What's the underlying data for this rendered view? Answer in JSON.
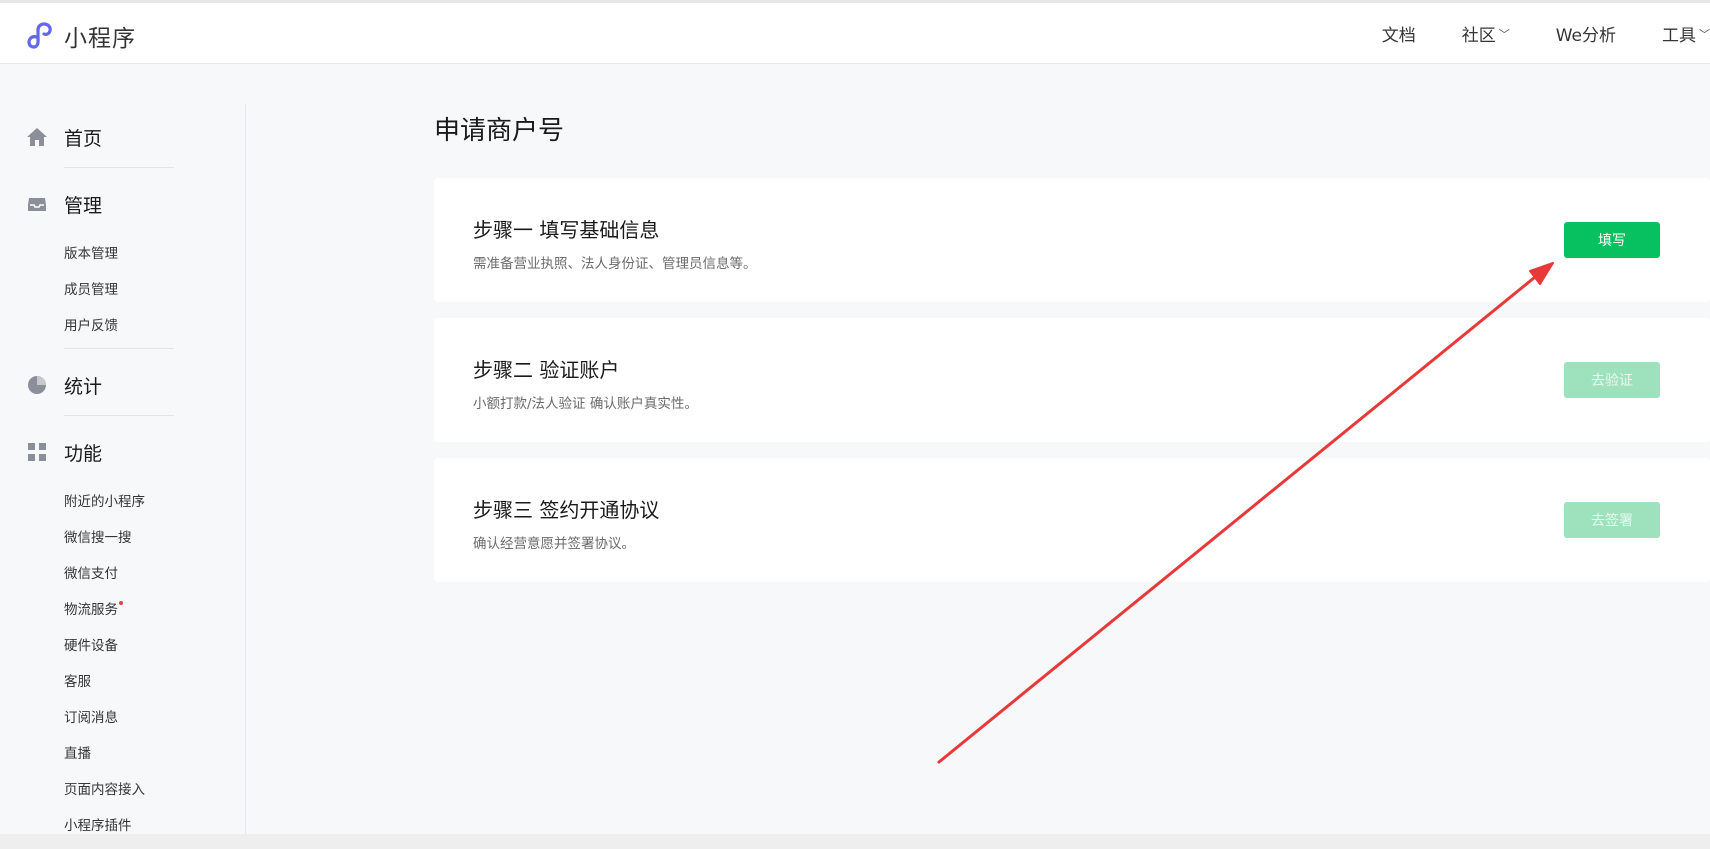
{
  "header": {
    "logo_text": "小程序",
    "nav": [
      {
        "label": "文档",
        "has_dropdown": false
      },
      {
        "label": "社区",
        "has_dropdown": true
      },
      {
        "label": "We分析",
        "has_dropdown": false
      },
      {
        "label": "工具",
        "has_dropdown": true
      }
    ]
  },
  "sidebar": {
    "home": {
      "label": "首页",
      "icon": "home-icon"
    },
    "manage": {
      "label": "管理",
      "icon": "inbox-icon",
      "items": [
        "版本管理",
        "成员管理",
        "用户反馈"
      ]
    },
    "stats": {
      "label": "统计",
      "icon": "pie-chart-icon"
    },
    "features": {
      "label": "功能",
      "icon": "grid-icon",
      "items": [
        "附近的小程序",
        "微信搜一搜",
        "微信支付",
        "物流服务",
        "硬件设备",
        "客服",
        "订阅消息",
        "直播",
        "页面内容接入",
        "小程序插件"
      ]
    }
  },
  "main": {
    "title": "申请商户号",
    "steps": [
      {
        "title": "步骤一 填写基础信息",
        "desc": "需准备营业执照、法人身份证、管理员信息等。",
        "button": "填写",
        "enabled": true
      },
      {
        "title": "步骤二 验证账户",
        "desc": "小额打款/法人验证 确认账户真实性。",
        "button": "去验证",
        "enabled": false
      },
      {
        "title": "步骤三 签约开通协议",
        "desc": "确认经营意愿并签署协议。",
        "button": "去签署",
        "enabled": false
      }
    ]
  },
  "colors": {
    "accent": "#07c160",
    "accent_disabled": "#9ee2bd",
    "annotation_arrow": "#e8393a",
    "logo": "#6467f0"
  }
}
